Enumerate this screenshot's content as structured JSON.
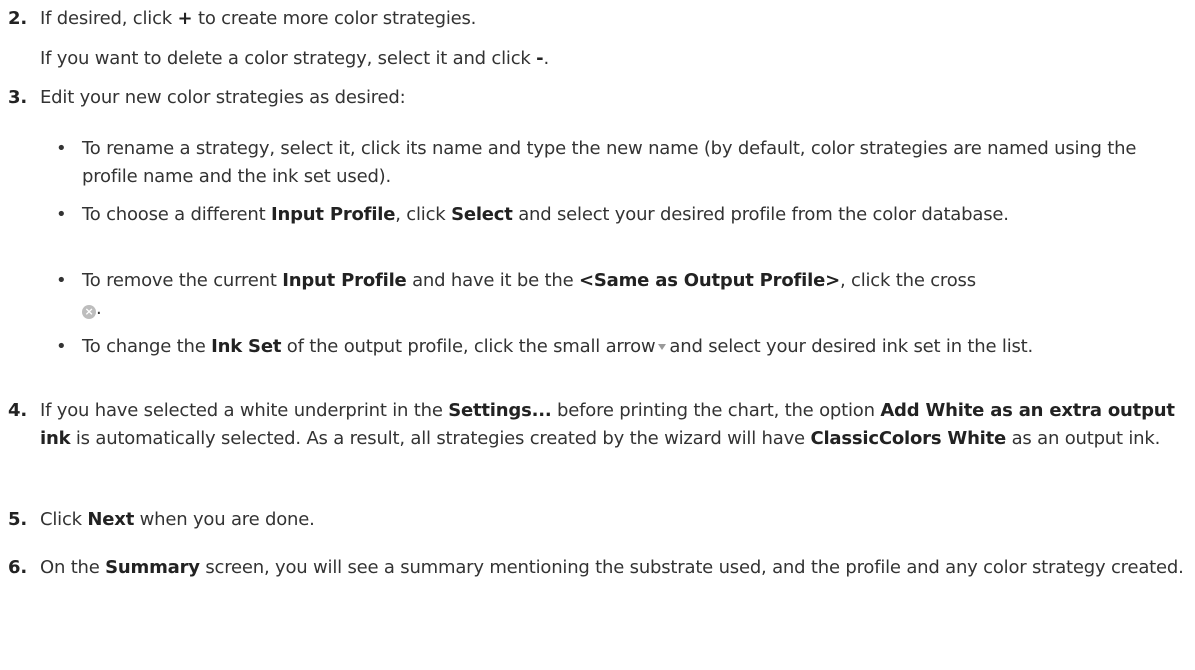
{
  "steps": [
    {
      "number": "2.",
      "line1_a": "If desired, click ",
      "line1_b": "+",
      "line1_c": " to create more color strategies.",
      "line2_a": "If you want to delete a color strategy, select it and click ",
      "line2_b": "-",
      "line2_c": "."
    },
    {
      "number": "3.",
      "text": "Edit your new color strategies as desired:",
      "bullets": [
        {
          "a": "To rename a strategy, select it, click its name and type the new name (by default, color strategies are named using the profile name and the ink set used)."
        },
        {
          "a": "To choose a different ",
          "b": "Input Profile",
          "c": ", click ",
          "d": "Select",
          "e": " and select your desired profile from the color database."
        },
        {
          "a": "To remove the current ",
          "b": "Input Profile",
          "c": " and have it be the ",
          "d": "<Same as Output Profile>",
          "e": ", click the cross",
          "f": "."
        },
        {
          "a": "To change the ",
          "b": "Ink Set",
          "c": " of the output profile, click the small arrow",
          "d": "and select your desired ink set in the list."
        }
      ]
    },
    {
      "number": "4.",
      "a": "If you have selected a white underprint in the ",
      "b": "Settings...",
      "c": " before printing the chart, the option ",
      "d": "Add White as an extra output ink",
      "e": " is automatically selected. As a result, all strategies created by the wizard will have ",
      "f": "ClassicColors White",
      "g": " as an output ink."
    },
    {
      "number": "5.",
      "a": "Click ",
      "b": "Next",
      "c": " when you are done."
    },
    {
      "number": "6.",
      "a": "On the ",
      "b": "Summary",
      "c": " screen, you will see a summary mentioning the substrate used, and the profile and any color strategy created."
    }
  ],
  "icons": {
    "cross": "cross-circle-icon",
    "arrow": "dropdown-arrow-icon"
  }
}
